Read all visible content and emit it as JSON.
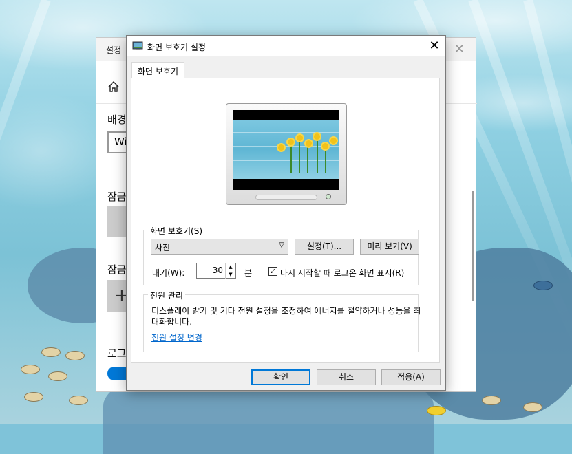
{
  "settings_window": {
    "title": "설정",
    "bg_label": "배경",
    "select_value": "Wi",
    "lock_label_1": "잠금",
    "lock_label_2": "잠금",
    "login_label": "로그"
  },
  "dialog": {
    "title": "화면 보호기 설정",
    "tab_label": "화면 보호기",
    "screensaver_group_label": "화면 보호기(S)",
    "screensaver_selected": "사진",
    "settings_button": "설정(T)...",
    "preview_button": "미리 보기(V)",
    "wait_label": "대기(W):",
    "wait_value": "30",
    "wait_unit": "분",
    "resume_logon_label": "다시 시작할 때 로그온 화면 표시(R)",
    "resume_logon_checked": true,
    "power_group_label": "전원 관리",
    "power_description": "디스플레이 밝기 및 기타 전원 설정을 조정하여 에너지를 절약하거나 성능을 최대화합니다.",
    "power_link": "전원 설정 변경",
    "ok_button": "확인",
    "cancel_button": "취소",
    "apply_button": "적용(A)"
  },
  "icons": {
    "close": "close-icon",
    "home": "home-icon",
    "dropdown": "chevron-down-icon",
    "display": "display-icon"
  },
  "colors": {
    "accent": "#0078d7",
    "link": "#0066cc"
  }
}
